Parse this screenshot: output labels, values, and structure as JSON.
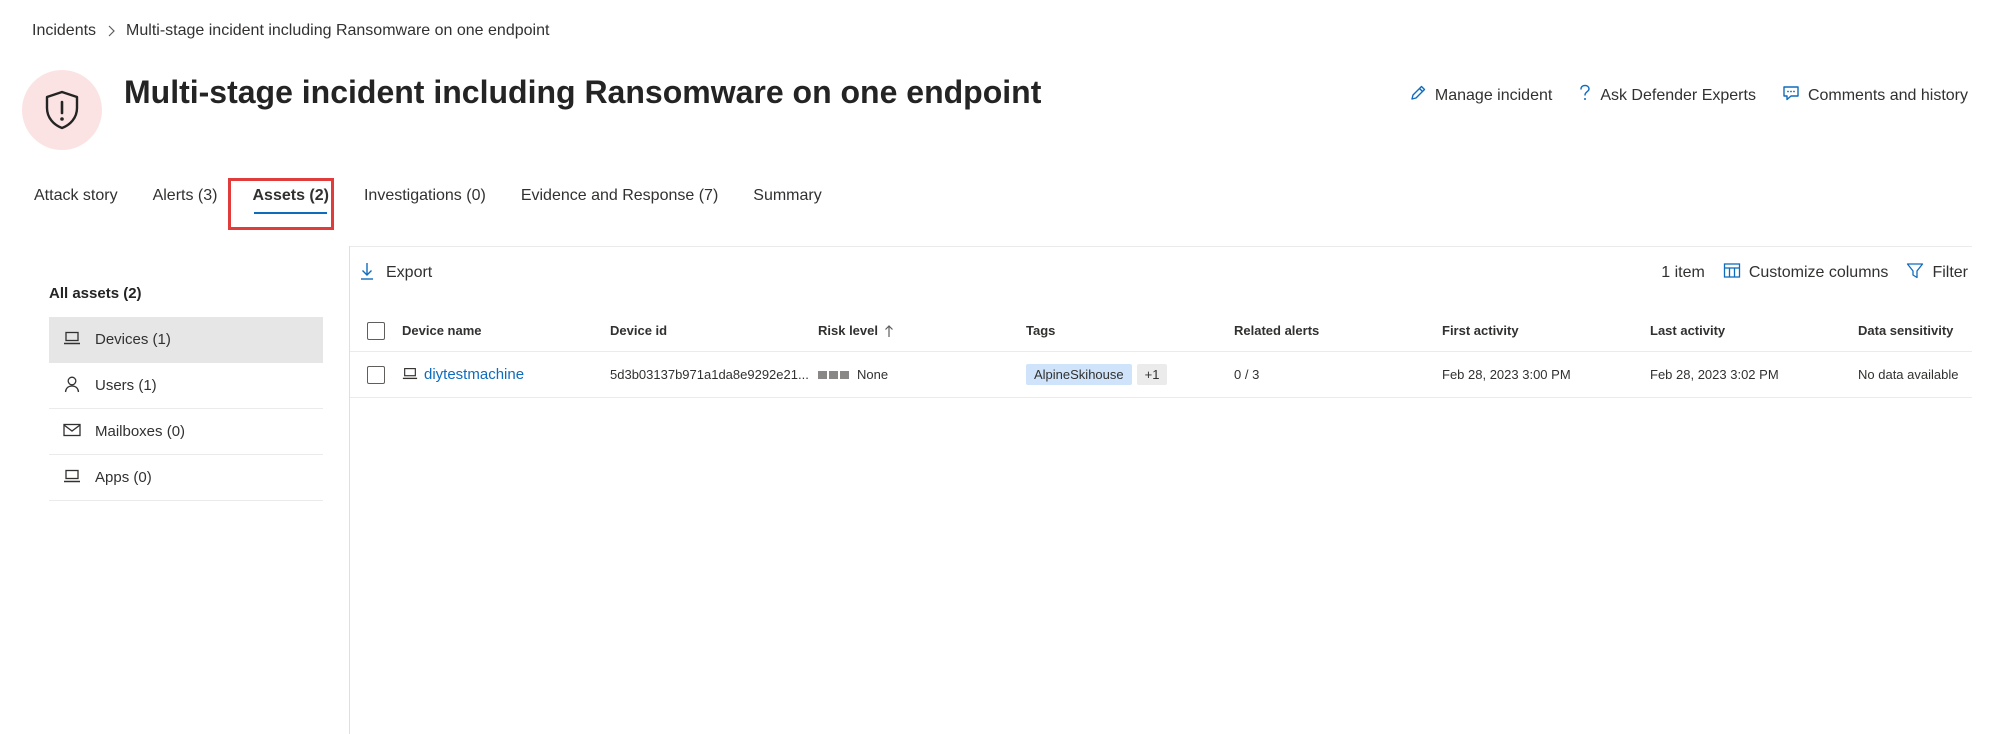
{
  "breadcrumb": {
    "parent": "Incidents",
    "current": "Multi-stage incident including Ransomware on one endpoint"
  },
  "header": {
    "title": "Multi-stage incident including Ransomware on one endpoint",
    "icon": "shield-alert-icon",
    "actions": {
      "manage": "Manage incident",
      "ask": "Ask Defender Experts",
      "comments": "Comments and history"
    }
  },
  "tabs": [
    {
      "label": "Attack story"
    },
    {
      "label": "Alerts (3)"
    },
    {
      "label": "Assets (2)"
    },
    {
      "label": "Investigations (0)"
    },
    {
      "label": "Evidence and Response (7)"
    },
    {
      "label": "Summary"
    }
  ],
  "left_panel": {
    "title": "All assets (2)",
    "items": [
      {
        "label": "Devices (1)",
        "icon": "laptop-icon"
      },
      {
        "label": "Users (1)",
        "icon": "person-icon"
      },
      {
        "label": "Mailboxes (0)",
        "icon": "mail-icon"
      },
      {
        "label": "Apps (0)",
        "icon": "laptop-icon"
      }
    ]
  },
  "toolbar": {
    "export": "Export",
    "count": "1 item",
    "customize": "Customize columns",
    "filter": "Filter"
  },
  "table": {
    "columns": {
      "device_name": "Device name",
      "device_id": "Device id",
      "risk_level": "Risk level",
      "tags": "Tags",
      "related_alerts": "Related alerts",
      "first_activity": "First activity",
      "last_activity": "Last activity",
      "data_sensitivity": "Data sensitivity"
    },
    "rows": [
      {
        "device_name": "diytestmachine",
        "device_id": "5d3b03137b971a1da8e9292e21...",
        "risk_level": "None",
        "tag": "AlpineSkihouse",
        "tag_more": "+1",
        "related_alerts": "0 / 3",
        "first_activity": "Feb 28, 2023 3:00 PM",
        "last_activity": "Feb 28, 2023 3:02 PM",
        "data_sensitivity": "No data available"
      }
    ]
  },
  "colors": {
    "accent": "#0f6cbd",
    "highlight": "#e03c3c",
    "icon_bg": "#fbe3e3",
    "tag_bg": "#cfe4fa"
  }
}
